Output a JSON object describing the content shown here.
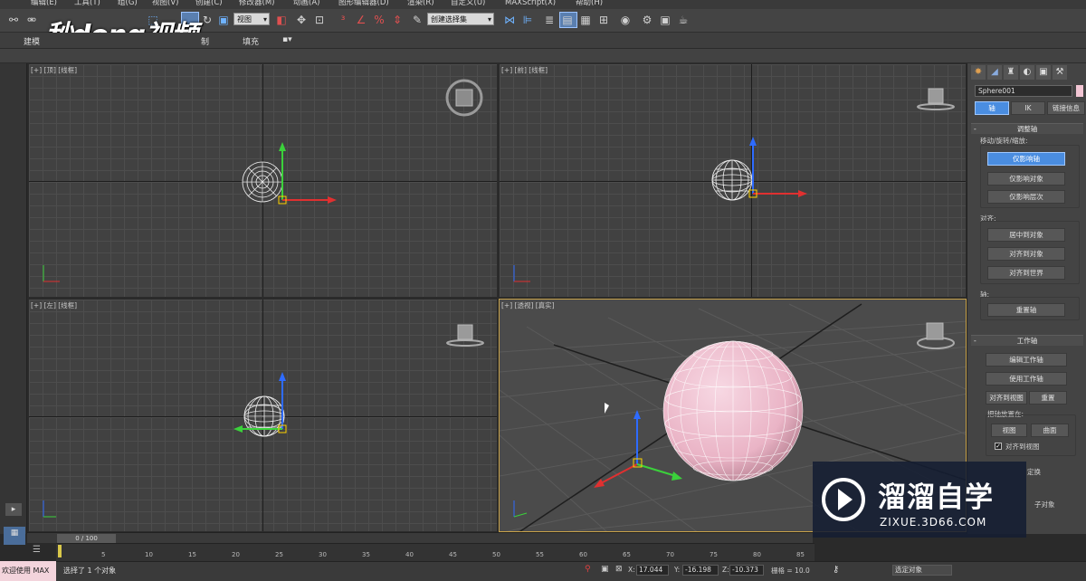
{
  "menu": [
    {
      "label": "编辑(E)"
    },
    {
      "label": "工具(T)"
    },
    {
      "label": "组(G)"
    },
    {
      "label": "视图(V)"
    },
    {
      "label": "创建(C)"
    },
    {
      "label": "修改器(M)"
    },
    {
      "label": "动画(A)"
    },
    {
      "label": "图形编辑器(D)"
    },
    {
      "label": "渲染(R)"
    },
    {
      "label": "自定义(U)"
    },
    {
      "label": "MAXScript(X)"
    },
    {
      "label": "帮助(H)"
    }
  ],
  "toolbar": {
    "view_dropdown": "视图",
    "selection_set_dropdown": "创建选择集"
  },
  "ribbon": {
    "tab_modeling": "建模",
    "tab_freeform": "制",
    "tab_fill": "填充"
  },
  "logo_text": "秒dong视频",
  "viewports": {
    "top": {
      "label": "[+] [顶] [线框]"
    },
    "front": {
      "label": "[+] [前] [线框]"
    },
    "left": {
      "label": "[+] [左] [线框]"
    },
    "perspective": {
      "label": "[+] [透视] [真实]"
    }
  },
  "command_panel": {
    "object_name": "Sphere001",
    "tab_pivot": "轴",
    "tab_ik": "IK",
    "tab_link_info": "链接信息",
    "adjust_pivot_title": "调整轴",
    "move_rotate_scale_label": "移动/旋转/缩放:",
    "affect_pivot_only": "仅影响轴",
    "affect_object_only": "仅影响对象",
    "affect_hierarchy_only": "仅影响层次",
    "alignment_label": "对齐:",
    "center_to_object": "居中到对象",
    "align_to_object": "对齐到对象",
    "align_to_world": "对齐到世界",
    "pivot_label": "轴:",
    "reset_pivot": "重置轴",
    "working_pivot_title": "工作轴",
    "edit_working_pivot": "编辑工作轴",
    "use_working_pivot": "使用工作轴",
    "align_to_view": "对齐到视图",
    "reset": "重置",
    "place_pivot_label": "把轴放置在:",
    "view": "视图",
    "surface": "曲面",
    "align_to_view_check": "对齐到视图",
    "transform_partial": "定换",
    "child_objects_partial": "子对象"
  },
  "timeline": {
    "slider": "0 / 100",
    "ticks": [
      "0",
      "5",
      "10",
      "15",
      "20",
      "25",
      "30",
      "35",
      "40",
      "45",
      "50",
      "55",
      "60",
      "65",
      "70",
      "75",
      "80",
      "85"
    ]
  },
  "status": {
    "message": "选择了 1 个对象",
    "x_label": "X:",
    "x_value": "17.044",
    "y_label": "Y:",
    "y_value": "-16.198",
    "z_label": "Z:",
    "z_value": "-10.373",
    "grid_text": "栅格 = 10.0",
    "maxscript_label": "欢迎使用 MAX",
    "selected_dropdown": "选定对象"
  },
  "watermark": {
    "title": "溜溜自学",
    "url": "ZIXUE.3D66.COM"
  },
  "colors": {
    "accent_blue": "#4a8de0",
    "sphere_pink": "#f0bfd0",
    "viewport_border_active": "#c8a24a"
  }
}
